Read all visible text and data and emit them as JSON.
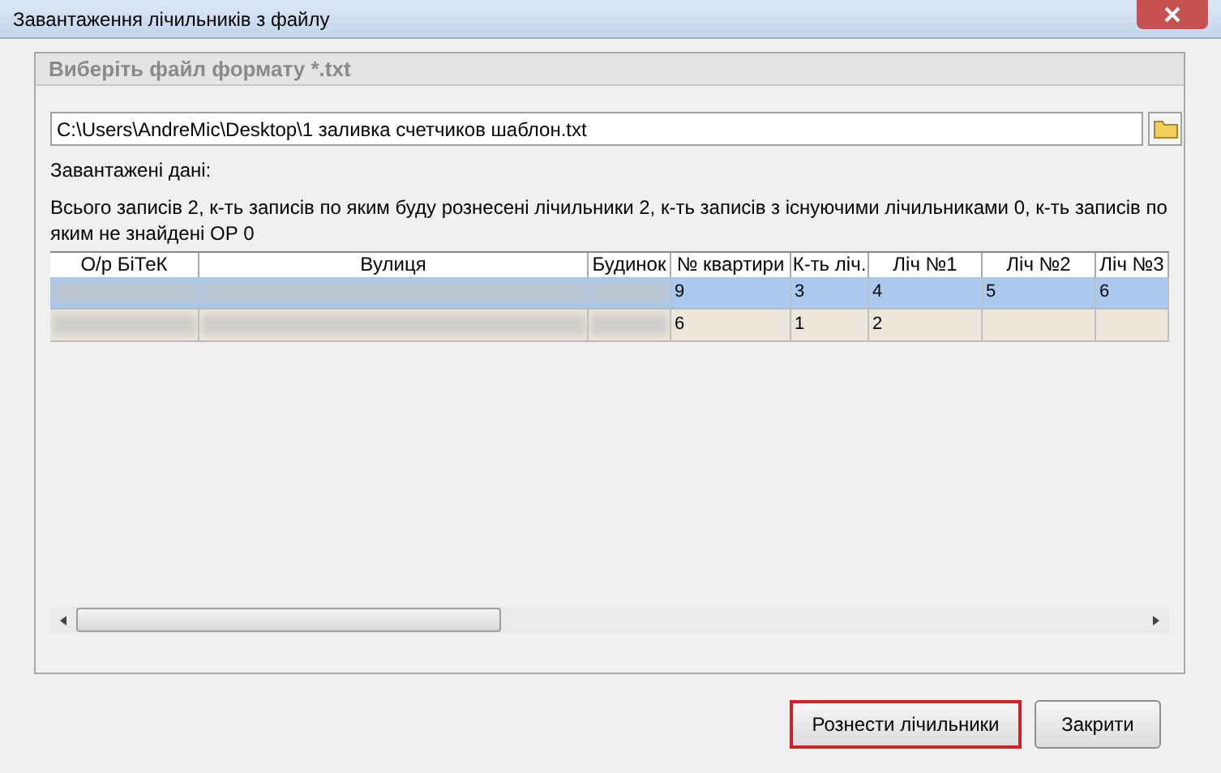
{
  "window": {
    "title": "Завантаження лічильників з файлу"
  },
  "group": {
    "title": "Виберіть файл формату *.txt"
  },
  "file_field": {
    "value": "C:\\Users\\AndreMic\\Desktop\\1 заливка счетчиков шаблон.txt"
  },
  "loaded_label": "Завантажені дані:",
  "summary": "Всього записів 2, к-ть записів по яким буду рознесені лічильники 2, к-ть записів з існуючими лічильниками 0, к-ть записів по яким не знайдені ОР 0",
  "table": {
    "columns": [
      "О/р БіТеК",
      "Вулиця",
      "Будинок",
      "№ квартири",
      "К-ть ліч.",
      "Ліч №1",
      "Ліч №2",
      "Ліч №3"
    ],
    "rows": [
      {
        "selected": true,
        "cells": [
          "",
          "",
          "",
          "9",
          "3",
          "4",
          "5",
          "6"
        ]
      },
      {
        "selected": false,
        "cells": [
          "",
          "",
          "",
          "6",
          "1",
          "2",
          "",
          ""
        ]
      }
    ]
  },
  "buttons": [
    {
      "label": "Рознести лічильники",
      "highlighted": true
    },
    {
      "label": "Закрити",
      "highlighted": false
    }
  ]
}
